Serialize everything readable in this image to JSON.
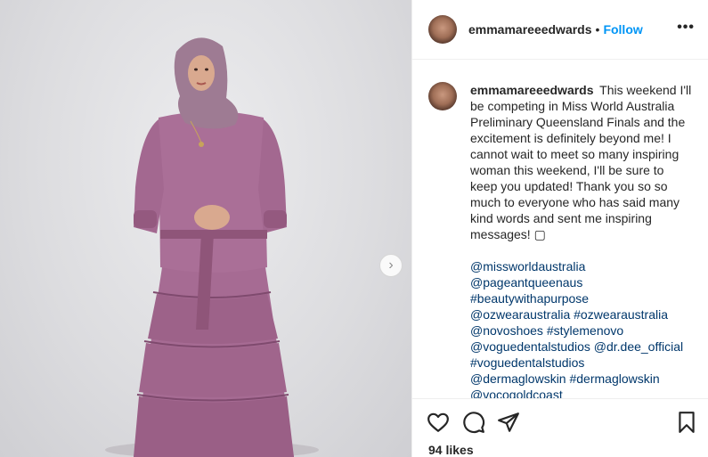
{
  "post": {
    "username": "emmamareeedwards",
    "separator": "•",
    "follow_label": "Follow",
    "more_label": "•••",
    "caption_text": "This weekend I'll be competing in Miss World Australia Preliminary Queensland Finals and the excitement is definitely beyond me! I cannot wait to meet so many inspiring woman this weekend, I'll be sure to keep you updated! Thank you so so much to everyone who has said many kind words and sent me inspiring messages! ▢",
    "tags": [
      "@missworldaustralia",
      "@pageantqueenaus",
      "#beautywithapurpose",
      "@ozwearaustralia #ozwearaustralia",
      "@novoshoes #stylemenovo",
      "@voguedentalstudios @dr.dee_official",
      "#voguedentalstudios",
      "@dermaglowskin #dermaglowskin",
      "@vocogoldcoast"
    ],
    "likes": "94 likes"
  },
  "icons": {
    "like": "heart-icon",
    "comment": "comment-icon",
    "share": "paper-plane-icon",
    "save": "bookmark-icon",
    "next": "chevron-right-icon"
  }
}
